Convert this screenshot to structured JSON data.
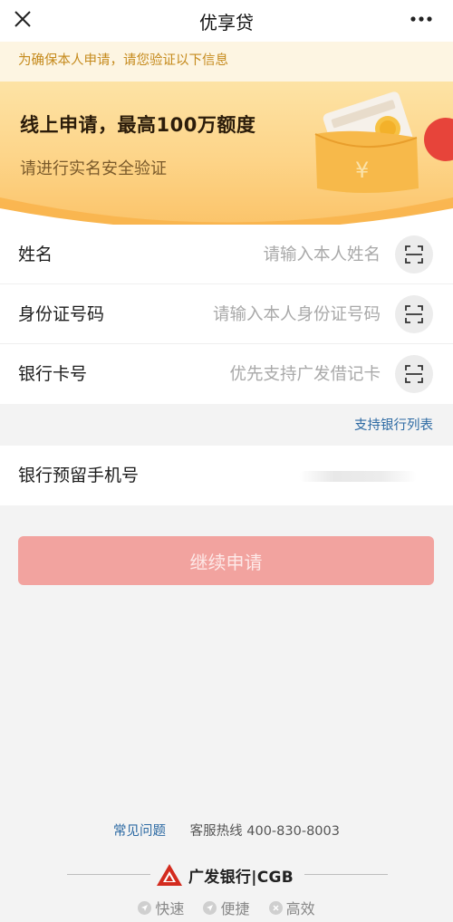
{
  "nav": {
    "title": "优享贷",
    "close_icon": "close-icon",
    "more_icon": "more-dots-icon"
  },
  "notice": {
    "text": "为确保本人申请，请您验证以下信息"
  },
  "banner": {
    "title": "线上申请，最高100万额度",
    "subtitle": "请进行实名安全验证"
  },
  "form": {
    "name": {
      "label": "姓名",
      "placeholder": "请输入本人姓名"
    },
    "id_number": {
      "label": "身份证号码",
      "placeholder": "请输入本人身份证号码"
    },
    "bank_card": {
      "label": "银行卡号",
      "placeholder": "优先支持广发借记卡"
    },
    "scan_icon": "scan-icon"
  },
  "bank_list": {
    "link_label": "支持银行列表"
  },
  "phone": {
    "label": "银行预留手机号"
  },
  "submit": {
    "label": "继续申请"
  },
  "footer": {
    "faq_label": "常见问题",
    "hotline": "客服热线 400-830-8003",
    "brand_name": "广发银行|CGB",
    "features": [
      "快速",
      "便捷",
      "高效"
    ]
  },
  "colors": {
    "accent_button": "#f2a39f",
    "notice_text": "#c58a1c",
    "link": "#2d6aa3",
    "banner": "#fdd488",
    "brand_red": "#d32b1e"
  }
}
